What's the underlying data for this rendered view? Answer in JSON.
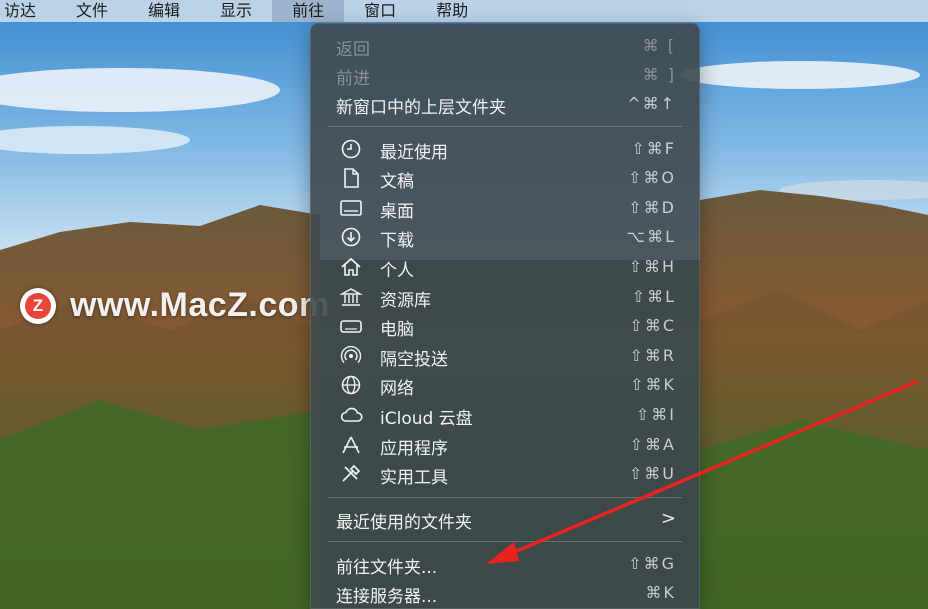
{
  "menubar": {
    "items": [
      "访达",
      "文件",
      "编辑",
      "显示",
      "前往",
      "窗口",
      "帮助"
    ],
    "active_index": 4
  },
  "watermark": {
    "logo_letter": "Z",
    "text": "www.MacZ.com"
  },
  "go_menu": {
    "nav": [
      {
        "label": "返回",
        "shortcut": "⌘ [",
        "enabled": false
      },
      {
        "label": "前进",
        "shortcut": "⌘ ]",
        "enabled": false
      },
      {
        "label": "新窗口中的上层文件夹",
        "shortcut": "^⌘↑",
        "enabled": true
      }
    ],
    "places": [
      {
        "label": "最近使用",
        "shortcut": "⇧⌘F",
        "icon": "clock-icon"
      },
      {
        "label": "文稿",
        "shortcut": "⇧⌘O",
        "icon": "document-icon"
      },
      {
        "label": "桌面",
        "shortcut": "⇧⌘D",
        "icon": "desktop-icon"
      },
      {
        "label": "下载",
        "shortcut": "⌥⌘L",
        "icon": "download-icon"
      },
      {
        "label": "个人",
        "shortcut": "⇧⌘H",
        "icon": "home-icon"
      },
      {
        "label": "资源库",
        "shortcut": "⇧⌘L",
        "icon": "library-icon"
      },
      {
        "label": "电脑",
        "shortcut": "⇧⌘C",
        "icon": "computer-icon"
      },
      {
        "label": "隔空投送",
        "shortcut": "⇧⌘R",
        "icon": "airdrop-icon"
      },
      {
        "label": "网络",
        "shortcut": "⇧⌘K",
        "icon": "network-icon"
      },
      {
        "label": "iCloud 云盘",
        "shortcut": "⇧⌘I",
        "icon": "cloud-icon"
      },
      {
        "label": "应用程序",
        "shortcut": "⇧⌘A",
        "icon": "applications-icon"
      },
      {
        "label": "实用工具",
        "shortcut": "⇧⌘U",
        "icon": "utilities-icon"
      }
    ],
    "recent_folders": {
      "label": "最近使用的文件夹",
      "submenu_glyph": ">"
    },
    "actions": [
      {
        "label": "前往文件夹...",
        "shortcut": "⇧⌘G"
      },
      {
        "label": "连接服务器...",
        "shortcut": "⌘K"
      }
    ]
  },
  "annotation": {
    "arrow_color": "#e8231f",
    "points_to": "前往文件夹..."
  }
}
